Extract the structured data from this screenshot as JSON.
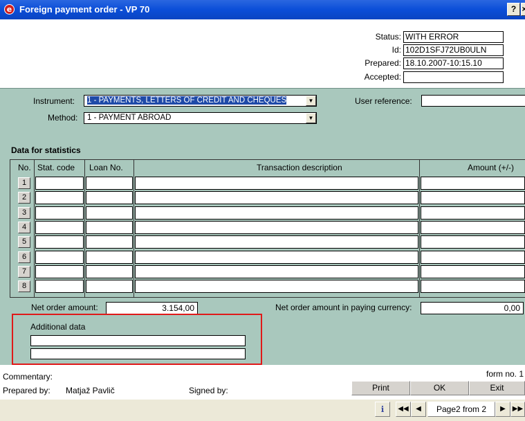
{
  "window": {
    "title": "Foreign payment order - VP 70",
    "logo_glyph": "e",
    "help_label": "?",
    "close_label": "×"
  },
  "status_panel": {
    "status_label": "Status:",
    "status_value": "WITH ERROR",
    "id_label": "Id:",
    "id_value": "102D1SFJ72UB0ULN",
    "prepared_label": "Prepared:",
    "prepared_value": "18.10.2007-10:15.10",
    "accepted_label": "Accepted:",
    "accepted_value": ""
  },
  "form": {
    "instrument_label": "Instrument:",
    "instrument_value": "1 - PAYMENTS, LETTERS OF CREDIT AND CHEQUES",
    "method_label": "Method:",
    "method_value": "1 - PAYMENT ABROAD",
    "user_reference_label": "User reference:",
    "user_reference_value": ""
  },
  "statistics": {
    "section_title": "Data for statistics",
    "columns": [
      "No.",
      "Stat. code",
      "Loan No.",
      "Transaction description",
      "Amount (+/-)"
    ],
    "rows": [
      {
        "no": "1"
      },
      {
        "no": "2"
      },
      {
        "no": "3"
      },
      {
        "no": "4"
      },
      {
        "no": "5"
      },
      {
        "no": "6"
      },
      {
        "no": "7"
      },
      {
        "no": "8"
      }
    ],
    "net_order_label": "Net order amount:",
    "net_order_value": "3.154,00",
    "net_paying_label": "Net order amount in paying currency:",
    "net_paying_value": "0,00"
  },
  "additional": {
    "label": "Additional data",
    "line1": "",
    "line2": ""
  },
  "footer": {
    "commentary_label": "Commentary:",
    "form_no_label": "form no. 1",
    "prepared_by_label": "Prepared by:",
    "prepared_by_name": "Matjaž Pavlič",
    "signed_by_label": "Signed by:",
    "print_label": "Print",
    "ok_label": "OK",
    "exit_label": "Exit"
  },
  "pager": {
    "page_text": "Page2 from 2",
    "first_glyph": "◀◀",
    "prev_glyph": "◀",
    "next_glyph": "▶",
    "last_glyph": "▶▶",
    "info_glyph": "ℹ"
  },
  "colors": {
    "panel_bg": "#a9c8bd",
    "title_bar": "#0b4ed8",
    "highlight_box": "#e01919",
    "selection": "#1f4aa8"
  }
}
